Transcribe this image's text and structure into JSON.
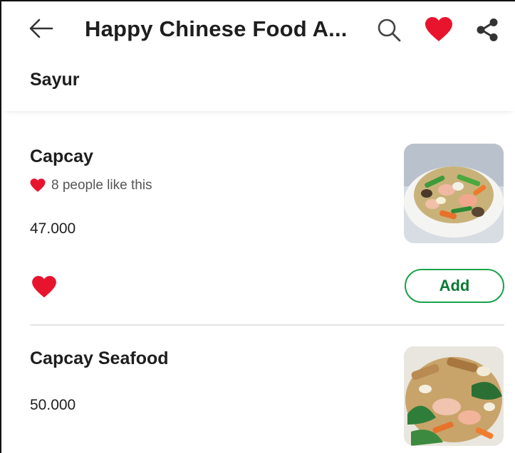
{
  "header": {
    "title": "Happy Chinese Food A...",
    "icons": [
      "back-arrow-icon",
      "search-icon",
      "heart-icon",
      "share-icon"
    ]
  },
  "section": {
    "title": "Sayur"
  },
  "items": [
    {
      "name": "Capcay",
      "likes_text": "8 people like this",
      "price": "47.000",
      "add_label": "Add"
    },
    {
      "name": "Capcay Seafood",
      "price": "50.000"
    }
  ],
  "colors": {
    "heart": "#e8142e",
    "add_border": "#1aa34a",
    "add_text": "#0c7a32"
  }
}
